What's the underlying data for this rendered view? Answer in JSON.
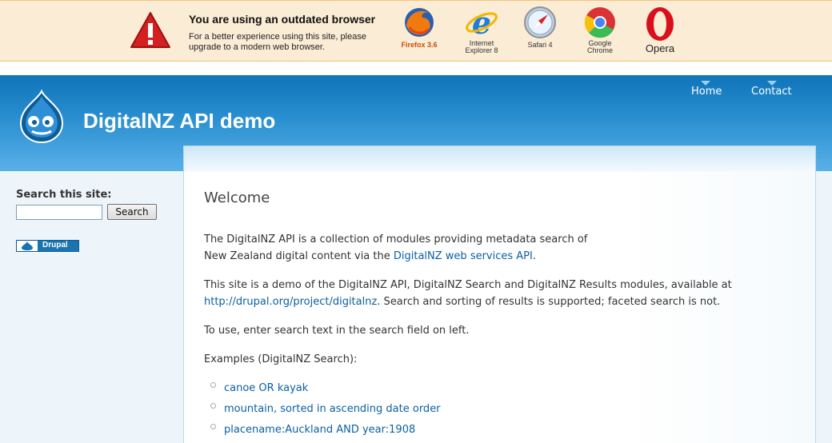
{
  "banner": {
    "title": "You are using an outdated browser",
    "text": "For a better experience using this site, please upgrade to a modern web browser.",
    "browsers": [
      {
        "name": "Firefox 3.6",
        "icon": "firefox-icon"
      },
      {
        "name_line1": "Internet",
        "name_line2": "Explorer 8",
        "icon": "internet-explorer-icon"
      },
      {
        "name": "Safari 4",
        "icon": "safari-icon"
      },
      {
        "name_line1": "Google",
        "name_line2": "Chrome",
        "icon": "chrome-icon"
      },
      {
        "name": "Opera",
        "icon": "opera-icon"
      }
    ]
  },
  "header": {
    "site_name": "DigitalNZ API demo",
    "nav": [
      {
        "label": "Home"
      },
      {
        "label": "Contact"
      }
    ]
  },
  "sidebar": {
    "search_label": "Search this site:",
    "search_value": "",
    "search_button": "Search",
    "badge": "Drupal"
  },
  "main": {
    "title": "Welcome",
    "p1_text": "The DigitalNZ API is a collection of modules providing metadata search of New Zealand digital content via the ",
    "p1_link": "DigitalNZ web services API",
    "p1_end": ".",
    "p2_text": "This site is a demo of the DigitalNZ API, DigitalNZ Search and DigitalNZ Results modules, available at ",
    "p2_link": "http://drupal.org/project/digitalnz",
    "p2_end": ". Search and sorting of results is supported; faceted search is not.",
    "p3_text": "To use, enter search text in the search field on left.",
    "p4_text": "Examples (DigitalNZ Search):",
    "examples": [
      {
        "label": "canoe OR kayak"
      },
      {
        "label": "mountain, sorted in ascending date order"
      },
      {
        "label": "placename:Auckland AND year:1908"
      }
    ]
  },
  "colors": {
    "header_blue": "#1f82c6",
    "link": "#0a5fa3",
    "banner_bg": "#fbecd5"
  }
}
